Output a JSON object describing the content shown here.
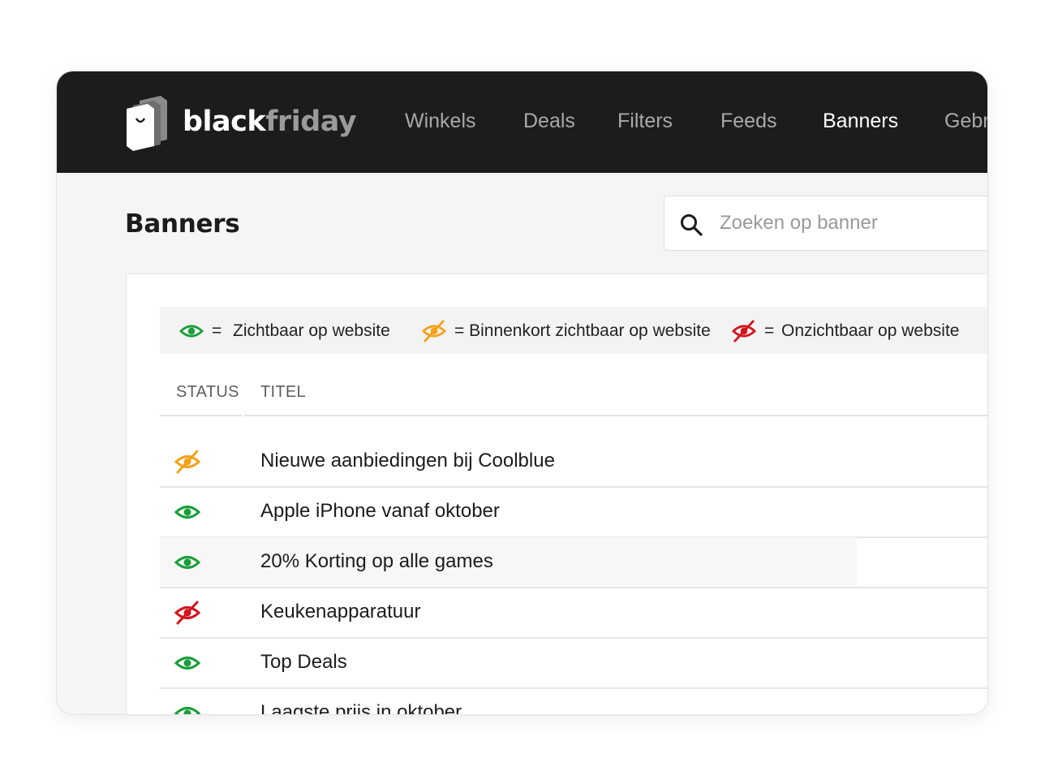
{
  "brand": {
    "part1": "black",
    "part2": "friday"
  },
  "nav": [
    {
      "label": "Winkels"
    },
    {
      "label": "Deals"
    },
    {
      "label": "Filters"
    },
    {
      "label": "Feeds"
    },
    {
      "label": "Banners",
      "active": true
    },
    {
      "label": "Gebr"
    }
  ],
  "page": {
    "title": "Banners"
  },
  "search": {
    "placeholder": "Zoeken op banner",
    "value": ""
  },
  "legend": {
    "visible": {
      "icon": "eye-icon",
      "eq": "=",
      "label": "Zichtbaar op website",
      "color": "#1a9e3a"
    },
    "soon": {
      "icon": "eye-slash-icon",
      "label": "= Binnenkort zichtbaar op website",
      "color": "#f5a21b"
    },
    "hidden": {
      "icon": "eye-slash-icon",
      "eq": "=",
      "label": "Onzichtbaar op website",
      "color": "#d4141c"
    }
  },
  "table": {
    "columns": [
      "STATUS",
      "TITEL"
    ],
    "rows": [
      {
        "status": "soon",
        "title": "Nieuwe aanbiedingen bij Coolblue"
      },
      {
        "status": "visible",
        "title": "Apple iPhone vanaf oktober"
      },
      {
        "status": "visible",
        "title": "20% Korting op alle games",
        "hovered": true
      },
      {
        "status": "hidden",
        "title": "Keukenapparatuur"
      },
      {
        "status": "visible",
        "title": "Top Deals"
      },
      {
        "status": "visible",
        "title": "Laagste prijs in oktober"
      }
    ]
  }
}
